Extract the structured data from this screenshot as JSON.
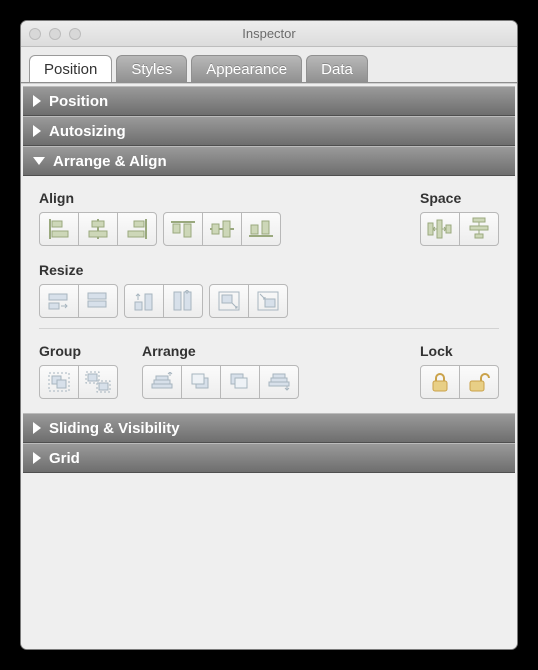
{
  "window": {
    "title": "Inspector"
  },
  "tabs": [
    {
      "label": "Position",
      "active": true
    },
    {
      "label": "Styles",
      "active": false
    },
    {
      "label": "Appearance",
      "active": false
    },
    {
      "label": "Data",
      "active": false
    }
  ],
  "sections": {
    "position": {
      "label": "Position",
      "expanded": false
    },
    "autosizing": {
      "label": "Autosizing",
      "expanded": false
    },
    "arrange": {
      "label": "Arrange & Align",
      "expanded": true
    },
    "sliding": {
      "label": "Sliding & Visibility",
      "expanded": false
    },
    "grid": {
      "label": "Grid",
      "expanded": false
    }
  },
  "groups": {
    "align": {
      "label": "Align"
    },
    "space": {
      "label": "Space"
    },
    "resize": {
      "label": "Resize"
    },
    "group": {
      "label": "Group"
    },
    "arrange": {
      "label": "Arrange"
    },
    "lock": {
      "label": "Lock"
    }
  },
  "colors": {
    "icon_olive": "#9aa97e",
    "icon_slate": "#a7b5bf",
    "lock_gold": "#caa24a"
  }
}
